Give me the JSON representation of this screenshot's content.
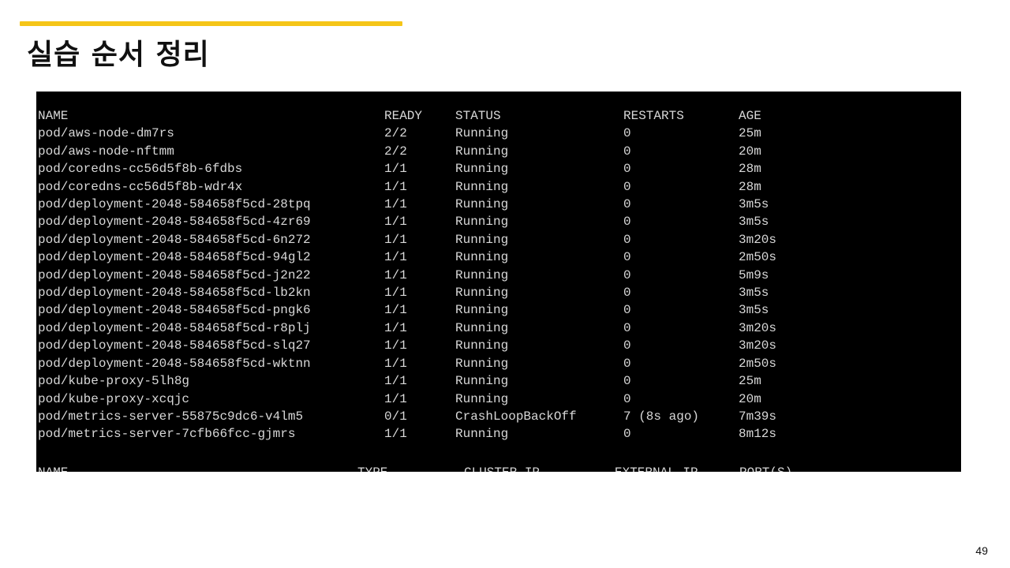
{
  "slide": {
    "title": "실습 순서 정리",
    "page_number": "49",
    "accent_color": "#f5c518"
  },
  "terminal": {
    "pods_table": {
      "headers": [
        "NAME",
        "READY",
        "STATUS",
        "RESTARTS",
        "AGE"
      ],
      "rows": [
        [
          "pod/aws-node-dm7rs",
          "2/2",
          "Running",
          "0",
          "25m"
        ],
        [
          "pod/aws-node-nftmm",
          "2/2",
          "Running",
          "0",
          "20m"
        ],
        [
          "pod/coredns-cc56d5f8b-6fdbs",
          "1/1",
          "Running",
          "0",
          "28m"
        ],
        [
          "pod/coredns-cc56d5f8b-wdr4x",
          "1/1",
          "Running",
          "0",
          "28m"
        ],
        [
          "pod/deployment-2048-584658f5cd-28tpq",
          "1/1",
          "Running",
          "0",
          "3m5s"
        ],
        [
          "pod/deployment-2048-584658f5cd-4zr69",
          "1/1",
          "Running",
          "0",
          "3m5s"
        ],
        [
          "pod/deployment-2048-584658f5cd-6n272",
          "1/1",
          "Running",
          "0",
          "3m20s"
        ],
        [
          "pod/deployment-2048-584658f5cd-94gl2",
          "1/1",
          "Running",
          "0",
          "2m50s"
        ],
        [
          "pod/deployment-2048-584658f5cd-j2n22",
          "1/1",
          "Running",
          "0",
          "5m9s"
        ],
        [
          "pod/deployment-2048-584658f5cd-lb2kn",
          "1/1",
          "Running",
          "0",
          "3m5s"
        ],
        [
          "pod/deployment-2048-584658f5cd-pngk6",
          "1/1",
          "Running",
          "0",
          "3m5s"
        ],
        [
          "pod/deployment-2048-584658f5cd-r8plj",
          "1/1",
          "Running",
          "0",
          "3m20s"
        ],
        [
          "pod/deployment-2048-584658f5cd-slq27",
          "1/1",
          "Running",
          "0",
          "3m20s"
        ],
        [
          "pod/deployment-2048-584658f5cd-wktnn",
          "1/1",
          "Running",
          "0",
          "2m50s"
        ],
        [
          "pod/kube-proxy-5lh8g",
          "1/1",
          "Running",
          "0",
          "25m"
        ],
        [
          "pod/kube-proxy-xcqjc",
          "1/1",
          "Running",
          "0",
          "20m"
        ],
        [
          "pod/metrics-server-55875c9dc6-v4lm5",
          "0/1",
          "CrashLoopBackOff",
          "7 (8s ago)",
          "7m39s"
        ],
        [
          "pod/metrics-server-7cfb66fcc-gjmrs",
          "1/1",
          "Running",
          "0",
          "8m12s"
        ]
      ]
    },
    "services_header": {
      "name": "NAME",
      "type": "TYPE",
      "cluster_ip": "CLUSTER-IP",
      "external_ip": "EXTERNAL-IP",
      "ports": "PORT(S)"
    }
  }
}
